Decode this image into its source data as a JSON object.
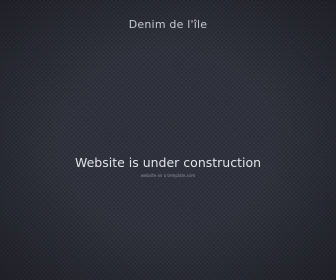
{
  "site": {
    "brand": "Denim de l'île"
  },
  "main": {
    "headline": "Website is under construction",
    "subline": "website on a template.com"
  },
  "colors": {
    "background": "#2d2f3a",
    "text": "#e2e3ea",
    "muted": "#8f919c"
  }
}
